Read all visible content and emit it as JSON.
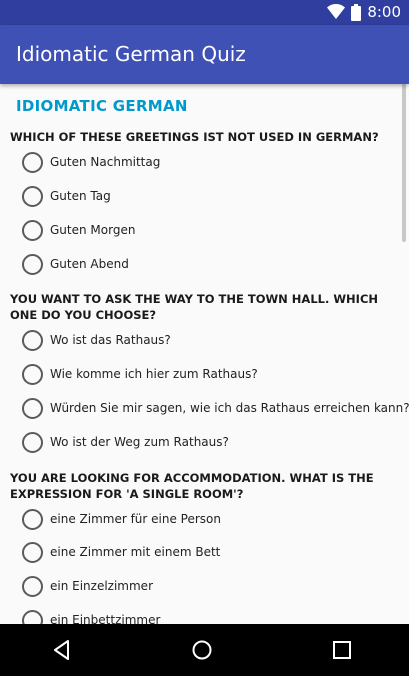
{
  "status_bar": {
    "time": "8:00",
    "icons": [
      "wifi-icon",
      "battery-icon"
    ]
  },
  "app_bar": {
    "title": "Idiomatic German Quiz"
  },
  "colors": {
    "app_bar": "#3f51b5",
    "status_bar": "#303f9f",
    "section_title": "#0099cc",
    "background": "#fafafa"
  },
  "quiz": {
    "section_title": "IDIOMATIC GERMAN",
    "questions": [
      {
        "text": "WHICH OF THESE GREETINGS IST NOT USED IN GERMAN?",
        "options": [
          "Guten Nachmittag",
          "Guten Tag",
          "Guten Morgen",
          "Guten Abend"
        ]
      },
      {
        "text": "YOU WANT TO ASK THE WAY TO THE TOWN HALL. WHICH ONE DO YOU CHOOSE?",
        "options": [
          "Wo ist das Rathaus?",
          "Wie komme ich hier zum Rathaus?",
          "Würden Sie mir sagen, wie ich das Rathaus erreichen kann?",
          "Wo ist der Weg zum Rathaus?"
        ]
      },
      {
        "text": "YOU ARE LOOKING FOR ACCOMMODATION. WHAT IS THE EXPRESSION FOR 'A SINGLE ROOM'?",
        "options": [
          "eine Zimmer für eine Person",
          "eine Zimmer mit einem Bett",
          "ein Einzelzimmer",
          "ein Einbettzimmer"
        ]
      }
    ]
  },
  "nav_bar": {
    "icons": [
      "back-icon",
      "home-icon",
      "recents-icon"
    ]
  }
}
